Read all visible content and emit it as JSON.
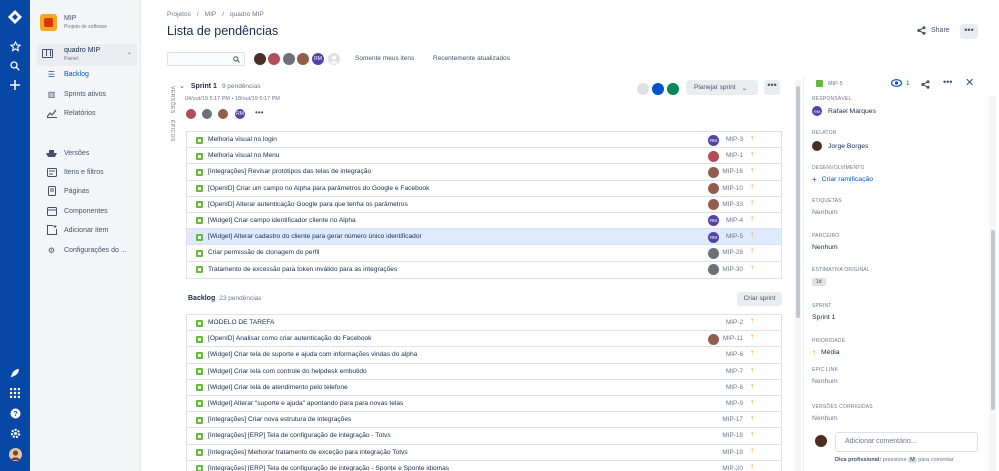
{
  "project": {
    "name": "MIP",
    "type": "Projeto de software"
  },
  "board": {
    "name": "quadro MIP",
    "subtitle": "Painel"
  },
  "nav": {
    "backlog": "Backlog",
    "sprints": "Sprints ativos",
    "reports": "Relatórios",
    "versions": "Versões",
    "issues": "Itens e filtros",
    "pages": "Páginas",
    "components": "Componentes",
    "add_item": "Adicionar item",
    "settings": "Configurações do ..."
  },
  "breadcrumb": {
    "a": "Projetos",
    "sep": "/",
    "b": "MIP",
    "c": "quadro MIP"
  },
  "page_title": "Lista de pendências",
  "share_label": "Share",
  "filters": {
    "only_my": "Somente meus itens",
    "recent": "Recentemente atualizados",
    "avatar_initials": "RM"
  },
  "side_labels": {
    "versions": "VERSÕES",
    "epics": "ÉPICOS"
  },
  "sprint": {
    "name": "Sprint 1",
    "count": "9 pendências",
    "dates": "04/out/19 5:17 PM • 18/out/19 5:17 PM",
    "plan_button": "Planejar sprint",
    "more": "•••",
    "avatar_initials": "RM"
  },
  "sprint_issues": [
    {
      "summary": "Melhoria visual no login",
      "key": "MIP-3",
      "assignee": "RM"
    },
    {
      "summary": "Melhoria visual no Menu",
      "key": "MIP-1",
      "assignee": ""
    },
    {
      "summary": "[Integrações] Revisar protótipos das telas de integração",
      "key": "MIP-16",
      "assignee": ""
    },
    {
      "summary": "[OpenID] Criar um campo no Alpha para parâmetros do Google e Facebook",
      "key": "MIP-10",
      "assignee": ""
    },
    {
      "summary": "[OpenID] Alterar autenticação Google para que tenha os parâmetros",
      "key": "MIP-33",
      "assignee": ""
    },
    {
      "summary": "[Widget] Criar campo identificador cliente no Alpha",
      "key": "MIP-4",
      "assignee": "RM"
    },
    {
      "summary": "[Widget] Alterar cadastro do cliente para gerar número único identificador",
      "key": "MIP-5",
      "assignee": "RM"
    },
    {
      "summary": "Criar permissão de clonagem do perfil",
      "key": "MIP-28",
      "assignee": ""
    },
    {
      "summary": "Tratamento de excessão para token inválido para as integrações",
      "key": "MIP-30",
      "assignee": ""
    }
  ],
  "backlog": {
    "title": "Backlog",
    "count": "23 pendências",
    "create_button": "Criar sprint"
  },
  "backlog_issues": [
    {
      "summary": "MODELO DE TAREFA",
      "key": "MIP-2"
    },
    {
      "summary": "[OpenID] Analisar como criar autenticação do Facebook",
      "key": "MIP-11"
    },
    {
      "summary": "[Widget] Criar tela de suporte e ajuda com informações vindas do alpha",
      "key": "MIP-6"
    },
    {
      "summary": "[Widget] Criar tela com controle do helpdesk embutido",
      "key": "MIP-7"
    },
    {
      "summary": "[Widget] Criar tela de atendimento pelo telefone",
      "key": "MIP-8"
    },
    {
      "summary": "[Widget] Alterar \"suporte e ajuda\" apontando para para novas telas",
      "key": "MIP-9"
    },
    {
      "summary": "[Integrações] Criar nova estrutura de integrações",
      "key": "MIP-17"
    },
    {
      "summary": "[Integrações] [ERP] Tela de configuração de integração - Totvs",
      "key": "MIP-18"
    },
    {
      "summary": "[Integrações] Melhorar tratamento de exceção para integração Totvs",
      "key": "MIP-19"
    },
    {
      "summary": "[Integrações] [ERP] Tela de configuração de integração - Sponte e Sponte idiomas",
      "key": "MIP-20"
    }
  ],
  "detail": {
    "key": "MIP-5",
    "watch_count": "1",
    "fields": {
      "responsavel_label": "RESPONSÁVEL",
      "responsavel_value": "Rafael Marques",
      "responsavel_initials": "RM",
      "relator_label": "RELATOR",
      "relator_value": "Jorge Borges",
      "dev_label": "DESENVOLVIMENTO",
      "dev_value": "Criar ramificação",
      "etiquetas_label": "ETIQUETAS",
      "etiquetas_value": "Nenhum",
      "parceiro_label": "PARCEIRO",
      "parceiro_value": "Nenhum",
      "estimativa_label": "ESTIMATIVA ORIGINAL",
      "estimativa_value": "1d",
      "sprint_label": "SPRINT",
      "sprint_value": "Sprint 1",
      "prioridade_label": "PRIORIDADE",
      "prioridade_value": "Média",
      "epic_label": "EPIC LINK",
      "epic_value": "Nenhum",
      "versoes_label": "VERSÕES CORRIGIDAS",
      "versoes_value": "Nenhum"
    },
    "comment_placeholder": "Adicionar comentário...",
    "tip_bold": "Dica profissional:",
    "tip_text": "pressione",
    "tip_key": "M",
    "tip_after": "para comentar"
  },
  "colors": {
    "nav": "#0747a6",
    "story": "#63ba3c",
    "priority": "#ff8b00",
    "link": "#0052cc",
    "selected": "#deebff"
  }
}
